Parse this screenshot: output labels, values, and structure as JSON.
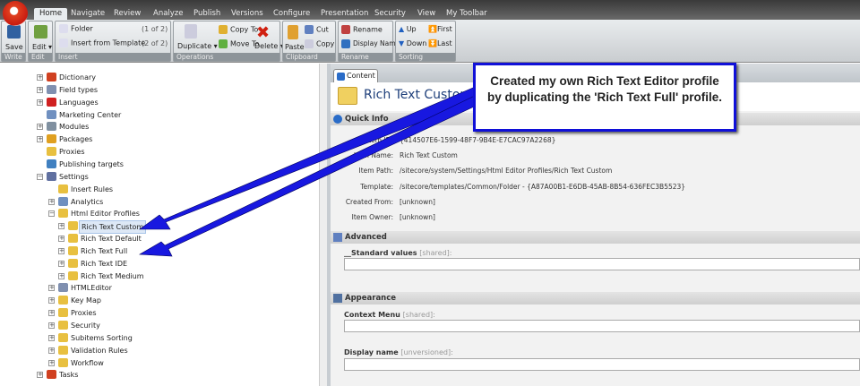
{
  "menu_tabs": [
    "Home",
    "Navigate",
    "Review",
    "Analyze",
    "Publish",
    "Versions",
    "Configure",
    "Presentation",
    "Security",
    "View",
    "My Toolbar"
  ],
  "ribbon": {
    "write": {
      "label": "Write",
      "save": "Save"
    },
    "edit": {
      "label": "Edit",
      "edit": "Edit ▾"
    },
    "insert": {
      "label": "Insert",
      "folder": "Folder",
      "folder_count": "(1 of 2)",
      "template": "Insert from Template",
      "template_count": "(2 of 2)"
    },
    "operations": {
      "label": "Operations",
      "duplicate": "Duplicate ▾",
      "copy_to": "Copy To",
      "move_to": "Move To",
      "delete": "Delete ▾"
    },
    "clipboard": {
      "label": "Clipboard",
      "paste": "Paste",
      "cut": "Cut",
      "copy": "Copy"
    },
    "rename": {
      "label": "Rename",
      "rename": "Rename",
      "display_name": "Display Name"
    },
    "sorting": {
      "label": "Sorting",
      "up": "Up",
      "down": "Down",
      "first": "First",
      "last": "Last"
    }
  },
  "tree": [
    {
      "label": "Dictionary",
      "level": 1,
      "color": "#d04020"
    },
    {
      "label": "Field types",
      "level": 1,
      "color": "#8090b0"
    },
    {
      "label": "Languages",
      "level": 1,
      "color": "#d02020"
    },
    {
      "label": "Marketing Center",
      "level": 1,
      "color": "#7090c0",
      "noexp": true
    },
    {
      "label": "Modules",
      "level": 1,
      "color": "#8090a0"
    },
    {
      "label": "Packages",
      "level": 1,
      "color": "#e0a020"
    },
    {
      "label": "Proxies",
      "level": 1,
      "color": "#e8c040",
      "noexp": true
    },
    {
      "label": "Publishing targets",
      "level": 1,
      "color": "#4080c0",
      "noexp": true
    },
    {
      "label": "Settings",
      "level": 1,
      "color": "#6070a0",
      "open": true
    },
    {
      "label": "Insert Rules",
      "level": 2,
      "color": "#e8c040",
      "noexp": true
    },
    {
      "label": "Analytics",
      "level": 2,
      "color": "#7090c0"
    },
    {
      "label": "Html Editor Profiles",
      "level": 2,
      "color": "#e8c040",
      "open": true
    },
    {
      "label": "Rich Text Custom",
      "level": 3,
      "color": "#e8c040",
      "selected": true
    },
    {
      "label": "Rich Text Default",
      "level": 3,
      "color": "#e8c040"
    },
    {
      "label": "Rich Text Full",
      "level": 3,
      "color": "#e8c040"
    },
    {
      "label": "Rich Text IDE",
      "level": 3,
      "color": "#e8c040"
    },
    {
      "label": "Rich Text Medium",
      "level": 3,
      "color": "#e8c040"
    },
    {
      "label": "HTMLEditor",
      "level": 2,
      "color": "#8090b0"
    },
    {
      "label": "Key Map",
      "level": 2,
      "color": "#e8c040"
    },
    {
      "label": "Proxies",
      "level": 2,
      "color": "#e8c040"
    },
    {
      "label": "Security",
      "level": 2,
      "color": "#e8c040"
    },
    {
      "label": "Subitems Sorting",
      "level": 2,
      "color": "#e8c040"
    },
    {
      "label": "Validation Rules",
      "level": 2,
      "color": "#e8c040"
    },
    {
      "label": "Workflow",
      "level": 2,
      "color": "#e8c040"
    },
    {
      "label": "Tasks",
      "level": 1,
      "color": "#d04020"
    }
  ],
  "content": {
    "tab": "Content",
    "title": "Rich Text Custom",
    "quick_info": {
      "header": "Quick Info",
      "rows": [
        {
          "label": "Item ID:",
          "value": "{414507E6-1599-48F7-9B4E-E7CAC97A2268}"
        },
        {
          "label": "Item Name:",
          "value": "Rich Text Custom"
        },
        {
          "label": "Item Path:",
          "value": "/sitecore/system/Settings/Html Editor Profiles/Rich Text Custom"
        },
        {
          "label": "Template:",
          "value": "/sitecore/templates/Common/Folder - {A87A00B1-E6DB-45AB-8B54-636FEC3B5523}"
        },
        {
          "label": "Created From:",
          "value": "[unknown]"
        },
        {
          "label": "Item Owner:",
          "value": "[unknown]"
        }
      ]
    },
    "advanced": {
      "header": "Advanced",
      "field": "__Standard values",
      "field_note": "[shared]:"
    },
    "appearance": {
      "header": "Appearance",
      "context_menu": "Context Menu",
      "context_note": "[shared]:",
      "display_name": "Display name",
      "display_note": "[unversioned]:"
    }
  },
  "callout": {
    "line1": "Created my own Rich Text Editor profile",
    "line2": "by duplicating the 'Rich Text Full' profile."
  }
}
